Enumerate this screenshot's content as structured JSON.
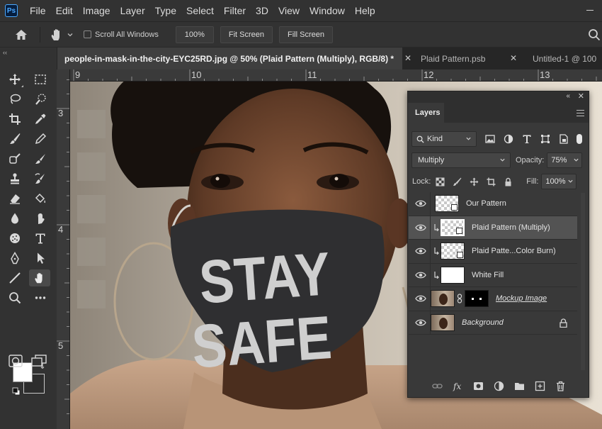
{
  "app": {
    "logo_text": "Ps"
  },
  "menu": [
    "File",
    "Edit",
    "Image",
    "Layer",
    "Type",
    "Select",
    "Filter",
    "3D",
    "View",
    "Window",
    "Help"
  ],
  "options": {
    "scroll_all_windows": "Scroll All Windows",
    "zoom": "100%",
    "fit_screen": "Fit Screen",
    "fill_screen": "Fill Screen"
  },
  "tabs": {
    "active": "people-in-mask-in-the-city-EYC25RD.jpg @ 50% (Plaid Pattern (Multiply), RGB/8) *",
    "second": "Plaid Pattern.psb",
    "third": "Untitled-1 @ 100"
  },
  "ruler": {
    "top": [
      "9",
      "10",
      "11",
      "12",
      "13"
    ],
    "left": [
      "3",
      "4",
      "5"
    ]
  },
  "canvas": {
    "mask_line1": "STAY",
    "mask_line2": "SAFE"
  },
  "layers_panel": {
    "title": "Layers",
    "kind": "Kind",
    "blend_mode": "Multiply",
    "opacity_label": "Opacity:",
    "opacity": "75%",
    "lock_label": "Lock:",
    "fill_label": "Fill:",
    "fill": "100%",
    "layers": [
      {
        "name": "Our Pattern"
      },
      {
        "name": "Plaid Pattern (Multiply)"
      },
      {
        "name": "Plaid Patte...Color Burn)"
      },
      {
        "name": "White Fill"
      },
      {
        "name": "Mockup Image"
      },
      {
        "name": "Background"
      }
    ]
  },
  "colors": {
    "accent": "#4aa8ff",
    "panel": "#393939",
    "selected_layer": "#535353"
  }
}
